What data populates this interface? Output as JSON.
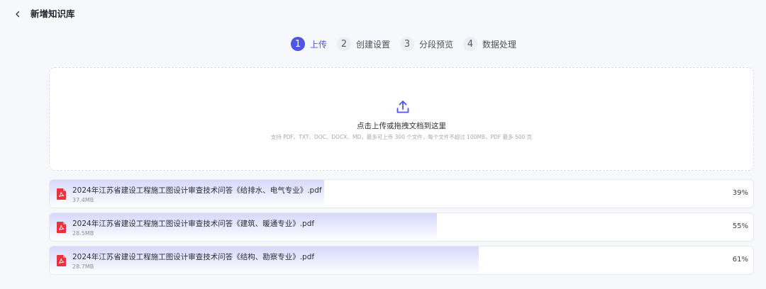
{
  "header": {
    "title": "新增知识库"
  },
  "steps": [
    {
      "num": "1",
      "label": "上传",
      "active": true
    },
    {
      "num": "2",
      "label": "创建设置",
      "active": false
    },
    {
      "num": "3",
      "label": "分段预览",
      "active": false
    },
    {
      "num": "4",
      "label": "数据处理",
      "active": false
    }
  ],
  "upload": {
    "title": "点击上传或拖拽文档到这里",
    "hint": "支持 PDF、TXT、DOC、DOCX、MD，最多可上传 300 个文件，每个文件不超过 100MB，PDF 最多 500 页"
  },
  "files": [
    {
      "name": "2024年江苏省建设工程施工图设计审查技术问答《给排水、电气专业》.pdf",
      "size": "37.4MB",
      "percent_label": "39%",
      "progress": 0.39
    },
    {
      "name": "2024年江苏省建设工程施工图设计审查技术问答《建筑、暖通专业》.pdf",
      "size": "28.5MB",
      "percent_label": "55%",
      "progress": 0.55
    },
    {
      "name": "2024年江苏省建设工程施工图设计审查技术问答《结构、勘察专业》.pdf",
      "size": "28.7MB",
      "percent_label": "61%",
      "progress": 0.61
    }
  ],
  "colors": {
    "accent": "#4f55e6",
    "pdf_red": "#e8323c"
  },
  "icons": {
    "back": "chevron-left-icon",
    "upload": "upload-icon",
    "file": "pdf-file-icon"
  }
}
